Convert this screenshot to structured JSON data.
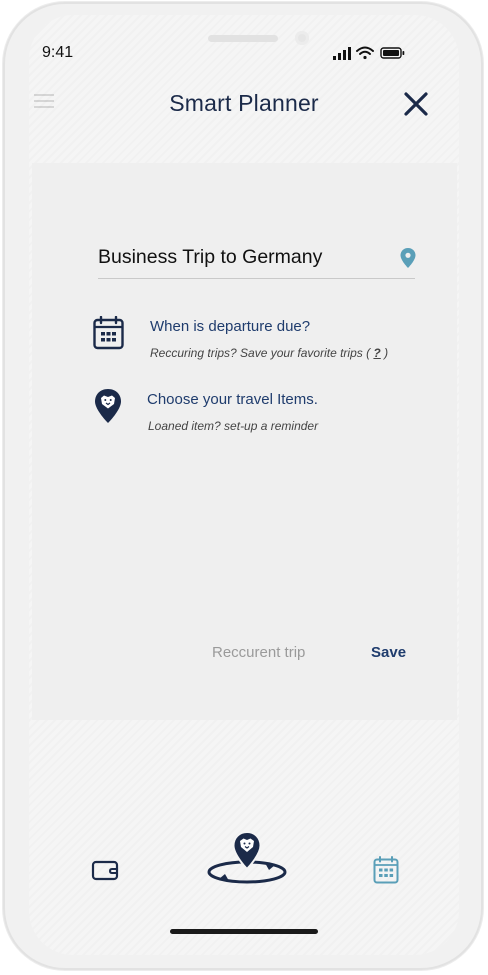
{
  "status_bar": {
    "time": "9:41"
  },
  "header": {
    "title": "Smart Planner"
  },
  "trip": {
    "name": "Business Trip to Germany"
  },
  "departure": {
    "heading": "When is departure due?",
    "subtext_prefix": "Reccuring trips? Save your favorite trips ( ",
    "help_link": "?",
    "subtext_suffix": " )"
  },
  "items": {
    "heading": "Choose your travel Items.",
    "subtext": "Loaned item? set-up a reminder"
  },
  "actions": {
    "recurrent_label": "Reccurent trip",
    "save_label": "Save"
  },
  "colors": {
    "navy": "#1b2a49",
    "accent_teal": "#5a9fb8",
    "muted": "#9a9a9a"
  },
  "bottom_nav": {
    "left_icon": "wallet-icon",
    "center_icon": "lion-planner-icon",
    "right_icon": "calendar-icon"
  }
}
